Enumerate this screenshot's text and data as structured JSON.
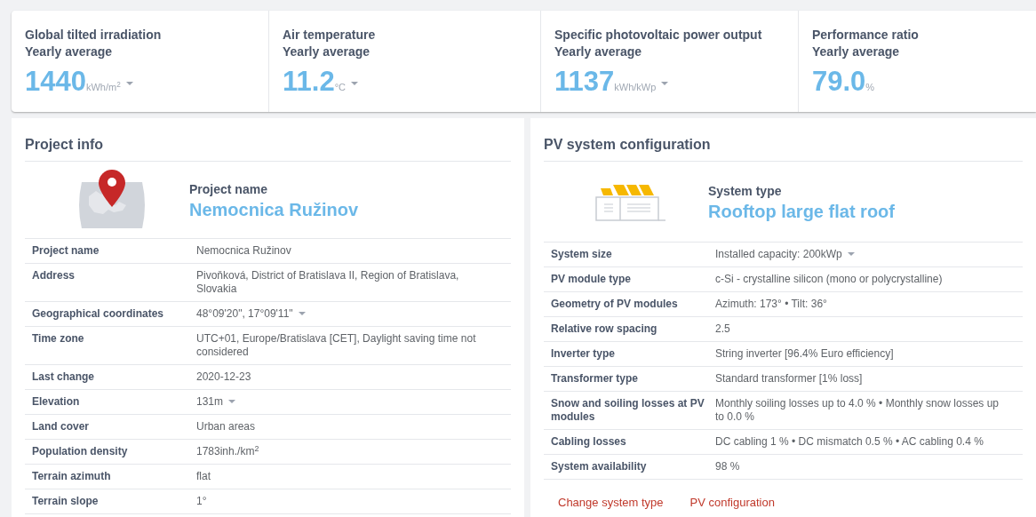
{
  "metrics": [
    {
      "title": "Global tilted irradiation",
      "subtitle": "Yearly average",
      "value": "1440",
      "unit": "kWh/m$^{2}$",
      "dropdown": true
    },
    {
      "title": "Air temperature",
      "subtitle": "Yearly average",
      "value": "11.2",
      "unit": "°C",
      "dropdown": true
    },
    {
      "title": "Specific photovoltaic power output",
      "subtitle": "Yearly average",
      "value": "1137",
      "unit": "kWh/kWp",
      "dropdown": true
    },
    {
      "title": "Performance ratio",
      "subtitle": "Yearly average",
      "value": "79.0",
      "unit": "%",
      "dropdown": false
    }
  ],
  "project_info": {
    "title": "Project info",
    "caption": "Project name",
    "name": "Nemocnica Ružinov",
    "rows": [
      {
        "label": "Project name",
        "value": "Nemocnica Ružinov",
        "dropdown": false
      },
      {
        "label": "Address",
        "value": "Pivoňková, District of Bratislava II, Region of Bratislava, Slovakia",
        "dropdown": false
      },
      {
        "label": "Geographical coordinates",
        "value": "48°09'20\", 17°09'11\"",
        "dropdown": true
      },
      {
        "label": "Time zone",
        "value": "UTC+01, Europe/Bratislava [CET], Daylight saving time not considered",
        "dropdown": false
      },
      {
        "label": "Last change",
        "value": "2020-12-23",
        "dropdown": false
      },
      {
        "label": "Elevation",
        "value": "131m",
        "dropdown": true
      },
      {
        "label": "Land cover",
        "value": "Urban areas",
        "dropdown": false
      },
      {
        "label": "Population density",
        "value": "1783inh./km$^{2}$",
        "dropdown": false
      },
      {
        "label": "Terrain azimuth",
        "value": "flat",
        "dropdown": false
      },
      {
        "label": "Terrain slope",
        "value": "1°",
        "dropdown": false
      }
    ]
  },
  "pv_system": {
    "title": "PV system configuration",
    "caption": "System type",
    "name": "Rooftop large flat roof",
    "rows": [
      {
        "label": "System size",
        "value": "Installed capacity: 200kWp",
        "dropdown": true
      },
      {
        "label": "PV module type",
        "value": "c-Si - crystalline silicon (mono or polycrystalline)",
        "dropdown": false
      },
      {
        "label": "Geometry of PV modules",
        "value": "Azimuth: 173° • Tilt: 36°",
        "dropdown": false
      },
      {
        "label": "Relative row spacing",
        "value": "2.5",
        "dropdown": false
      },
      {
        "label": "Inverter type",
        "value": "String inverter [96.4% Euro efficiency]",
        "dropdown": false
      },
      {
        "label": "Transformer type",
        "value": "Standard transformer [1% loss]",
        "dropdown": false
      },
      {
        "label": "Snow and soiling losses at PV modules",
        "value": "Monthly soiling losses up to 4.0 % • Monthly snow losses up to 0.0 %",
        "dropdown": false
      },
      {
        "label": "Cabling losses",
        "value": "DC cabling 1 % • DC mismatch 0.5 % • AC cabling 0.4 %",
        "dropdown": false
      },
      {
        "label": "System availability",
        "value": "98 %",
        "dropdown": false
      }
    ],
    "links": [
      "Change system type",
      "PV configuration"
    ]
  }
}
